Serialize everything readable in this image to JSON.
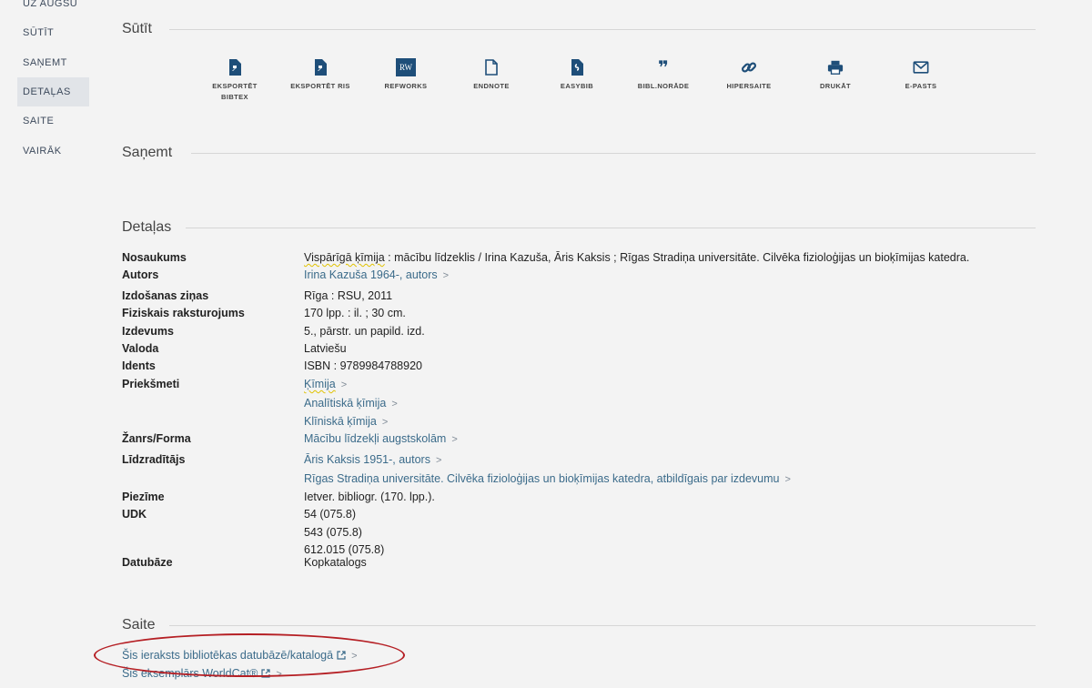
{
  "side_nav": {
    "items": [
      {
        "label": "Uz augšu"
      },
      {
        "label": "Sūtīt"
      },
      {
        "label": "Saņemt"
      },
      {
        "label": "Detaļas"
      },
      {
        "label": "Saite"
      },
      {
        "label": "Vairāk"
      }
    ],
    "active": "Detaļas"
  },
  "sections": {
    "send": "Sūtīt",
    "get": "Saņemt",
    "details": "Detaļas",
    "link": "Saite"
  },
  "send_actions": [
    {
      "label_1": "Eksportēt",
      "label_2": "BibTeX",
      "icon": "export-bibtex-icon"
    },
    {
      "label_1": "Eksportēt RIS",
      "label_2": "",
      "icon": "export-ris-icon"
    },
    {
      "label_1": "RefWorks",
      "label_2": "",
      "icon": "refworks-icon",
      "icon_text": "RW"
    },
    {
      "label_1": "EndNote",
      "label_2": "",
      "icon": "endnote-icon"
    },
    {
      "label_1": "EasyBib",
      "label_2": "",
      "icon": "easybib-icon"
    },
    {
      "label_1": "Bibl.norāde",
      "label_2": "",
      "icon": "citation-quote-icon",
      "icon_text": "❞"
    },
    {
      "label_1": "Hipersaite",
      "label_2": "",
      "icon": "link-icon"
    },
    {
      "label_1": "Drukāt",
      "label_2": "",
      "icon": "printer-icon"
    },
    {
      "label_1": "E-pasts",
      "label_2": "",
      "icon": "mail-icon"
    }
  ],
  "details": {
    "title_label": "Nosaukums",
    "title_main": "Vispārīgā ķīmija",
    "title_rest": " : mācību līdzeklis / Irina Kazuša, Āris Kaksis ; Rīgas Stradiņa universitāte. Cilvēka fizioloģijas un bioķīmijas katedra.",
    "author_label": "Autors",
    "author": "Irina Kazuša 1964-, autors",
    "pub_label": "Izdošanas ziņas",
    "pub": "Rīga : RSU, 2011",
    "phys_label": "Fiziskais raksturojums",
    "phys": "170 lpp. : il. ; 30 cm.",
    "edition_label": "Izdevums",
    "edition": "5., pārstr. un papild. izd.",
    "lang_label": "Valoda",
    "lang": "Latviešu",
    "ident_label": "Idents",
    "ident": "ISBN : 9789984788920",
    "subjects_label": "Priekšmeti",
    "subjects": [
      "Ķīmija",
      "Analītiskā ķīmija",
      "Klīniskā ķīmija"
    ],
    "genre_label": "Žanrs/Forma",
    "genre": "Mācību līdzekļi augstskolām",
    "contrib_label": "Līdzradītājs",
    "contrib": [
      "Āris Kaksis 1951-, autors",
      "Rīgas Stradiņa universitāte. Cilvēka fizioloģijas un bioķīmijas katedra, atbildīgais par izdevumu"
    ],
    "note_label": "Piezīme",
    "note": "Ietver. bibliogr. (170. lpp.).",
    "udk_label": "UDK",
    "udk": [
      "54 (075.8)",
      "543 (075.8)",
      "612.015 (075.8)"
    ],
    "db_label": "Datubāze",
    "db": "Kopkatalogs"
  },
  "links": {
    "catalog": "Šis ieraksts bibliotēkas datubāzē/katalogā",
    "worldcat": "Šis eksemplārs WorldCat®"
  },
  "colors": {
    "accent": "#1e4e79",
    "link": "#3b6b8a",
    "annotation": "#b51f24"
  }
}
